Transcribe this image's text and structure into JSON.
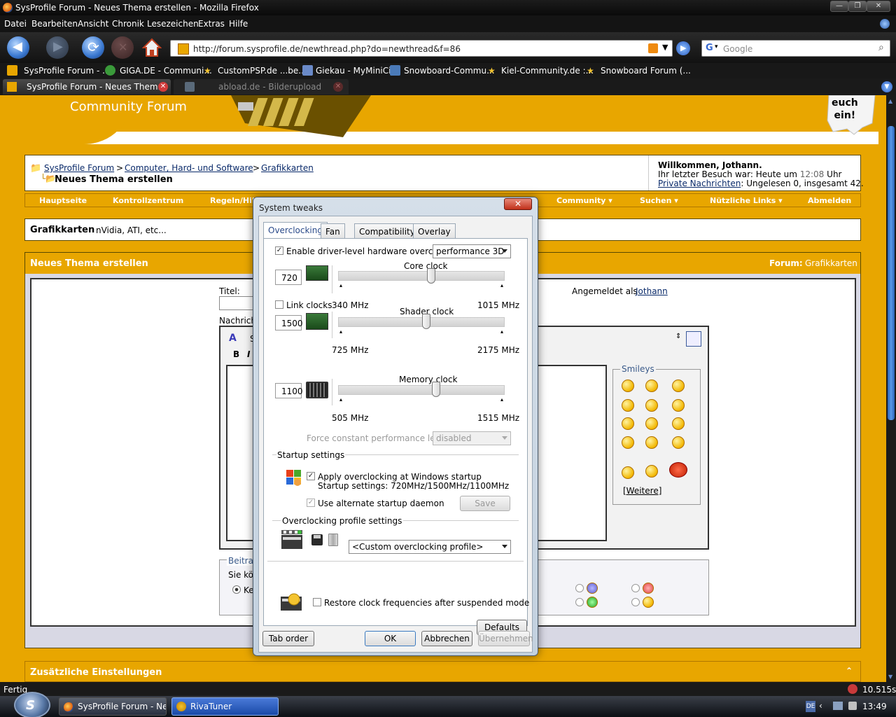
{
  "browser": {
    "window_title": "SysProfile Forum - Neues Thema erstellen - Mozilla Firefox",
    "menu": [
      "Datei",
      "Bearbeiten",
      "Ansicht",
      "Chronik",
      "Lesezeichen",
      "Extras",
      "Hilfe"
    ],
    "url": "http://forum.sysprofile.de/newthread.php?do=newthread&f=86",
    "search_placeholder": "Google",
    "bookmarks": [
      "SysProfile Forum - ...",
      "GIGA.DE - Communi...",
      "CustomPSP.de ...be...",
      "Giekau - MyMiniCity",
      "Snowboard-Commu...",
      "Kiel-Community.de :...",
      "Snowboard Forum (..."
    ],
    "tabs": [
      "SysProfile Forum - Neues Them...",
      "abload.de - Bilderupload"
    ],
    "status": "Fertig",
    "status_right": "10.515s"
  },
  "forum": {
    "header_sub": "Community Forum",
    "badge": "euch\nein!",
    "breadcrumb": [
      "SysProfile Forum",
      "Computer, Hard- und Software",
      "Grafikkarten"
    ],
    "sep": ">",
    "page_heading": "Neues Thema erstellen",
    "welcome_title": "Willkommen, Jothann.",
    "last_visit_label": "Ihr letzter Besuch war: Heute um",
    "last_visit_time": "12:08",
    "last_visit_suffix": "Uhr",
    "pm_link": "Private Nachrichten",
    "pm_text": ": Ungelesen 0, insgesamt 42.",
    "nav": [
      "Hauptseite",
      "Kontrollzentrum",
      "Regeln/Hilf",
      "Community ▾",
      "Suchen ▾",
      "Nützliche Links ▾",
      "Abmelden"
    ],
    "subforum_title": "Grafikkarten",
    "subforum_desc": "nVidia, ATI, etc...",
    "section_title": "Neues Thema erstellen",
    "forum_label": "Forum:",
    "forum_value": "Grafikkarten",
    "titel_label": "Titel:",
    "nachricht_label": "Nachrich",
    "logged_in_as": "Angemeldet als",
    "user": "Jothann",
    "smileys_title": "Smileys",
    "smileys_more": "[Weitere]",
    "beitrags_label": "Beitrags",
    "sie_ko": "Sie kö",
    "ke": "Ke",
    "extra_settings": "Zusätzliche Einstellungen"
  },
  "dialog": {
    "title": "System tweaks",
    "tabs": [
      "Overclocking",
      "Fan",
      "Compatibility",
      "Overlay"
    ],
    "enable_label": "Enable driver-level hardware overclocking",
    "enable_checked": true,
    "mode": "performance 3D",
    "core_label": "Core clock",
    "core_value": "720",
    "core_min": "340 MHz",
    "core_max": "1015 MHz",
    "core_pos": 0.56,
    "link_clocks": "Link clocks",
    "shader_label": "Shader clock",
    "shader_value": "1500",
    "shader_min": "725 MHz",
    "shader_max": "2175 MHz",
    "shader_pos": 0.53,
    "memory_label": "Memory clock",
    "memory_value": "1100",
    "memory_min": "505 MHz",
    "memory_max": "1515 MHz",
    "memory_pos": 0.59,
    "force_label": "Force constant performance level",
    "force_value": "disabled",
    "startup_group": "Startup settings",
    "apply_label": "Apply overclocking at Windows startup",
    "startup_settings": "Startup settings: 720MHz/1500MHz/1100MHz",
    "daemon_label": "Use alternate startup daemon",
    "save": "Save",
    "profile_group": "Overclocking profile settings",
    "profile": "<Custom overclocking profile>",
    "restore_label": "Restore clock frequencies after suspended mode",
    "defaults": "Defaults",
    "tab_order": "Tab order",
    "ok": "OK",
    "cancel": "Abbrechen",
    "apply": "Übernehmen"
  },
  "taskbar": {
    "tasks": [
      "SysProfile Forum - Ne...",
      "RivaTuner"
    ],
    "lang": "DE",
    "clock": "13:49"
  }
}
